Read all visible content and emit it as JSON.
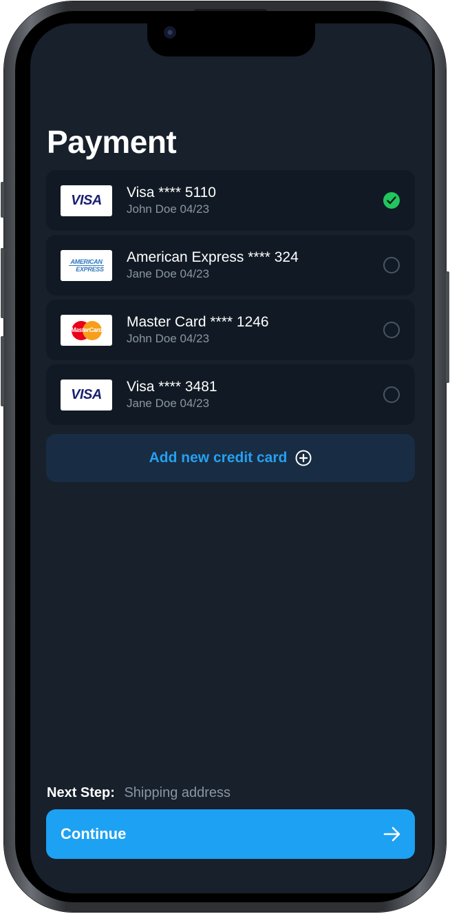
{
  "page": {
    "title": "Payment"
  },
  "cards": [
    {
      "brand": "visa",
      "logo_text": "VISA",
      "name": "Visa **** 5110",
      "meta": "John Doe 04/23",
      "selected": true
    },
    {
      "brand": "amex",
      "logo_text_1": "AMERICAN",
      "logo_text_2": "EXPRESS",
      "name": "American Express **** 324",
      "meta": "Jane Doe 04/23",
      "selected": false
    },
    {
      "brand": "mastercard",
      "logo_text": "MasterCard",
      "name": "Master Card **** 1246",
      "meta": "John Doe 04/23",
      "selected": false
    },
    {
      "brand": "visa",
      "logo_text": "VISA",
      "name": "Visa **** 3481",
      "meta": "Jane Doe 04/23",
      "selected": false
    }
  ],
  "add_card": {
    "label": "Add new credit card",
    "icon": "plus-circle-icon"
  },
  "next_step": {
    "label": "Next Step:",
    "value": "Shipping address"
  },
  "continue_button": {
    "label": "Continue",
    "icon": "arrow-right-icon"
  },
  "colors": {
    "background": "#17202b",
    "card_bg": "#111a24",
    "accent": "#1da1f2",
    "link": "#26a0f0",
    "selected": "#22c55e",
    "muted_text": "#8a96a3"
  }
}
